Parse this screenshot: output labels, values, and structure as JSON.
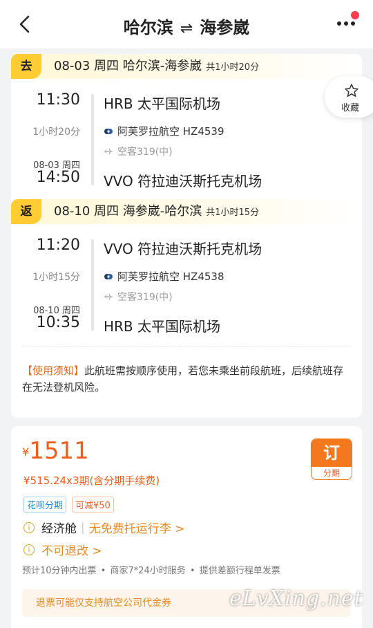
{
  "header": {
    "from": "哈尔滨",
    "swap": "⇌",
    "to": "海参崴",
    "colors": {
      "dot": "#ff3b4e"
    }
  },
  "favorite": {
    "label": "收藏"
  },
  "outbound": {
    "tag": "去",
    "date_route": "08-03 周四 哈尔滨-海参崴",
    "total": "共1小时20分",
    "dep_time": "11:30",
    "dep_airport": "HRB 太平国际机场",
    "duration": "1小时20分",
    "airline": "阿芙罗拉航空 HZ4539",
    "aircraft": "空客319(中)",
    "arr_date": "08-03 周四",
    "arr_time": "14:50",
    "arr_airport": "VVO 符拉迪沃斯托克机场"
  },
  "return": {
    "tag": "返",
    "date_route": "08-10 周四 海参崴-哈尔滨",
    "total": "共1小时15分",
    "dep_time": "11:20",
    "dep_airport": "VVO 符拉迪沃斯托克机场",
    "duration": "1小时15分",
    "airline": "阿芙罗拉航空 HZ4538",
    "aircraft": "空客319(中)",
    "arr_date": "08-10 周四",
    "arr_time": "10:35",
    "arr_airport": "HRB 太平国际机场"
  },
  "notice": {
    "key": "【使用须知】",
    "text": "此航班需按顺序使用，若您未乘坐前段航班，后续航班存在无法登机风险。"
  },
  "price": {
    "currency": "¥",
    "amount": "1511",
    "installment": "¥515.24x3期(含分期手续费)",
    "tag1": "花呗分期",
    "tag2": "可减¥50",
    "cabin": "经济舱",
    "baggage": "无免费托运行李 >",
    "refund": "不可退改 >",
    "services": "预计10分钟内出票 • 商家7*24小时服务 • 提供差额行程单发票",
    "coupon": "退票可能仅支持航空公司代金券",
    "book_label": "订",
    "book_sub": "分期",
    "colors": {
      "accent": "#f25c19"
    }
  },
  "watermark": "eLvXing.net"
}
